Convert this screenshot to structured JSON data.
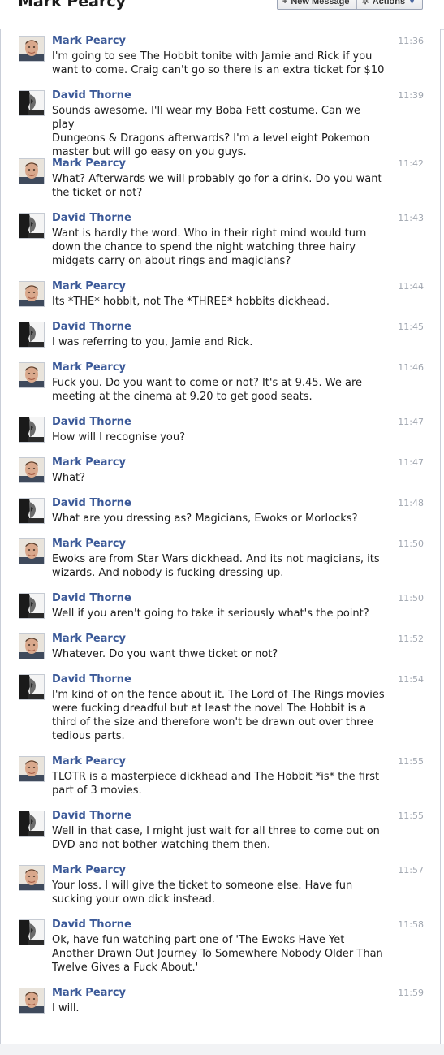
{
  "header": {
    "title": "Mark Pearcy",
    "new_message_label": "New Message",
    "actions_label": "Actions"
  },
  "icons": {
    "new_message": "plus-icon",
    "actions": "gear-icon",
    "dropdown": "chevron-down-icon"
  },
  "colors": {
    "sender_link": "#3b5998",
    "timestamp": "#a0a6b0",
    "divider": "#d8dce6"
  },
  "messages": [
    {
      "sender": "Mark Pearcy",
      "avatar": "mark",
      "time": "11:36",
      "lines": [
        "I'm going to see The Hobbit tonite with Jamie and Rick if you",
        "want to come. Craig can't go so there is an extra ticket for $10"
      ]
    },
    {
      "sender": "David Thorne",
      "avatar": "david",
      "time": "11:39",
      "lines": [
        "Sounds awesome. I'll wear my Boba Fett costume. Can we play",
        "Dungeons & Dragons afterwards? I'm a level eight Pokemon",
        "master but will go easy on you guys."
      ]
    },
    {
      "sender": "Mark Pearcy",
      "avatar": "mark",
      "time": "11:42",
      "lines": [
        "What? Afterwards we will probably go for a drink. Do you want",
        "the ticket or not?"
      ]
    },
    {
      "sender": "David Thorne",
      "avatar": "david",
      "time": "11:43",
      "lines": [
        "Want is hardly the word. Who in their right mind would turn",
        "down the chance to spend the night watching three hairy",
        "midgets carry on about rings and magicians?"
      ]
    },
    {
      "sender": "Mark Pearcy",
      "avatar": "mark",
      "time": "11:44",
      "lines": [
        "Its *THE* hobbit, not The *THREE* hobbits dickhead."
      ]
    },
    {
      "sender": "David Thorne",
      "avatar": "david",
      "time": "11:45",
      "lines": [
        "I was referring to you, Jamie and Rick."
      ]
    },
    {
      "sender": "Mark Pearcy",
      "avatar": "mark",
      "time": "11:46",
      "lines": [
        "Fuck you. Do you want to come or not? It's at 9.45. We are",
        "meeting at the cinema at 9.20 to get good seats."
      ]
    },
    {
      "sender": "David Thorne",
      "avatar": "david",
      "time": "11:47",
      "lines": [
        "How will I recognise you?"
      ]
    },
    {
      "sender": "Mark Pearcy",
      "avatar": "mark",
      "time": "11:47",
      "lines": [
        "What?"
      ]
    },
    {
      "sender": "David Thorne",
      "avatar": "david",
      "time": "11:48",
      "lines": [
        "What are you dressing as? Magicians, Ewoks or Morlocks?"
      ]
    },
    {
      "sender": "Mark Pearcy",
      "avatar": "mark",
      "time": "11:50",
      "lines": [
        "Ewoks are from Star Wars dickhead. And its not magicians, its",
        "wizards. And nobody is fucking dressing up."
      ]
    },
    {
      "sender": "David Thorne",
      "avatar": "david",
      "time": "11:50",
      "lines": [
        "Well if you aren't going to take it seriously what's the point?"
      ]
    },
    {
      "sender": "Mark Pearcy",
      "avatar": "mark",
      "time": "11:52",
      "lines": [
        "Whatever. Do you want thwe ticket or not?"
      ]
    },
    {
      "sender": "David Thorne",
      "avatar": "david",
      "time": "11:54",
      "lines": [
        "I'm kind of on the fence about it. The Lord of The Rings movies",
        "were fucking dreadful but at least the novel The Hobbit is a",
        "third of the size and therefore won't be drawn out over three",
        "tedious parts."
      ]
    },
    {
      "sender": "Mark Pearcy",
      "avatar": "mark",
      "time": "11:55",
      "lines": [
        "TLOTR is a masterpiece dickhead and The Hobbit *is* the first",
        "part of 3 movies."
      ]
    },
    {
      "sender": "David Thorne",
      "avatar": "david",
      "time": "11:55",
      "lines": [
        "Well in that case, I might just wait for all three to come out on",
        "DVD and not bother watching them then."
      ]
    },
    {
      "sender": "Mark Pearcy",
      "avatar": "mark",
      "time": "11:57",
      "lines": [
        "Your loss. I will give the ticket to someone else. Have fun",
        "sucking your own dick instead."
      ]
    },
    {
      "sender": "David Thorne",
      "avatar": "david",
      "time": "11:58",
      "lines": [
        "Ok, have fun watching part one of 'The Ewoks Have Yet",
        "Another Drawn Out Journey To Somewhere Nobody Older Than",
        "Twelve Gives a Fuck About.'"
      ]
    },
    {
      "sender": "Mark Pearcy",
      "avatar": "mark",
      "time": "11:59",
      "lines": [
        "I will."
      ]
    }
  ]
}
